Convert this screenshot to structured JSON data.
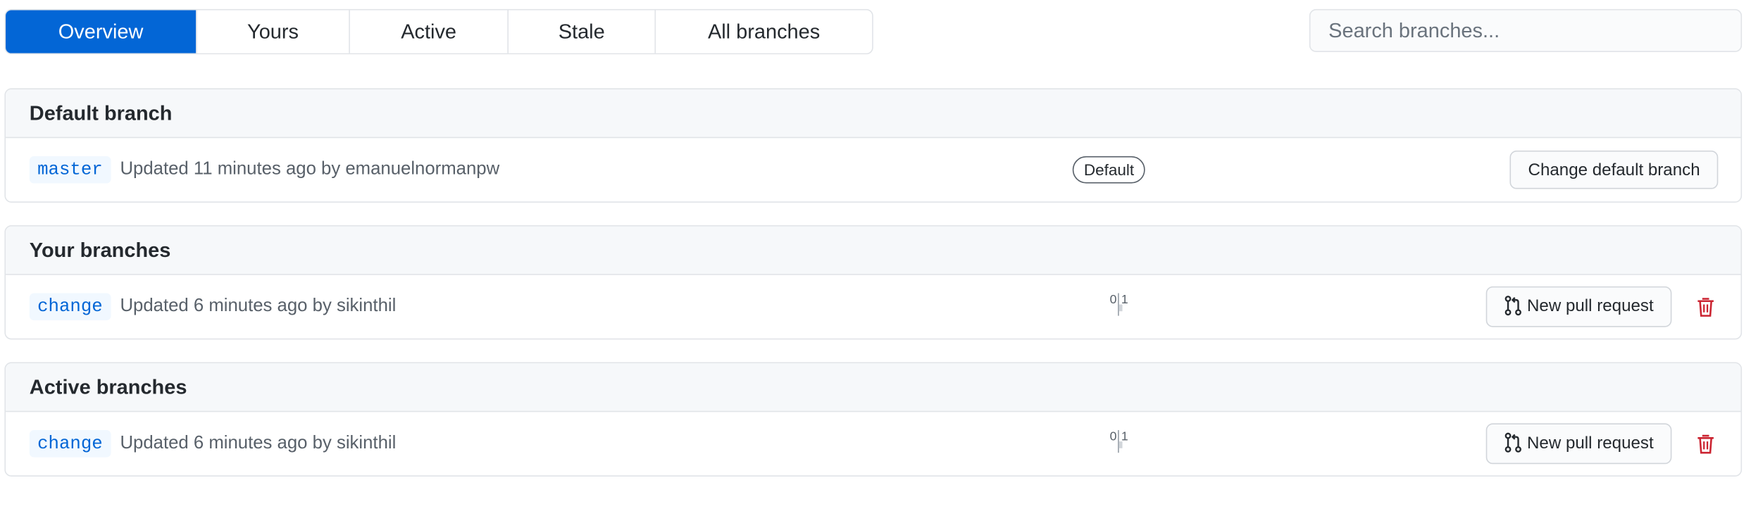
{
  "tabs": [
    {
      "label": "Overview",
      "selected": true
    },
    {
      "label": "Yours",
      "selected": false
    },
    {
      "label": "Active",
      "selected": false
    },
    {
      "label": "Stale",
      "selected": false
    },
    {
      "label": "All branches",
      "selected": false
    }
  ],
  "search": {
    "placeholder": "Search branches...",
    "value": ""
  },
  "default_section": {
    "title": "Default branch",
    "branch": {
      "name": "master",
      "updated": "Updated 11 minutes ago by emanuelnormanpw",
      "badge": "Default",
      "action_label": "Change default branch"
    }
  },
  "your_section": {
    "title": "Your branches",
    "branch": {
      "name": "change",
      "updated": "Updated 6 minutes ago by sikinthil",
      "behind": "0",
      "ahead": "1",
      "action_label": "New pull request",
      "delete_icon": "trash-icon"
    }
  },
  "active_section": {
    "title": "Active branches",
    "branch": {
      "name": "change",
      "updated": "Updated 6 minutes ago by sikinthil",
      "behind": "0",
      "ahead": "1",
      "action_label": "New pull request",
      "delete_icon": "trash-icon"
    }
  },
  "colors": {
    "accent": "#0366d6",
    "danger": "#cb2431",
    "branch_bg": "#f1f8ff",
    "header_bg": "#f6f8fa",
    "border": "#e1e4e8"
  }
}
